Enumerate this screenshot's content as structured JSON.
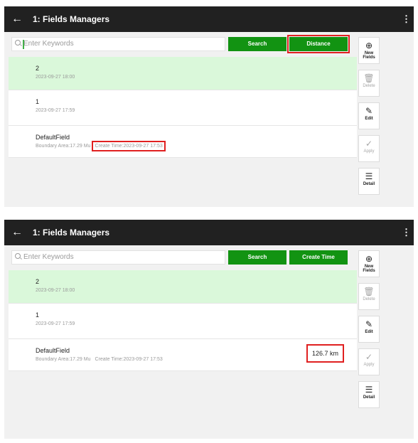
{
  "screens": [
    {
      "header": {
        "back": "←",
        "title": "1: Fields Managers",
        "menu": "⋮"
      },
      "search": {
        "placeholder": "Enter Keywords",
        "search_label": "Search",
        "sort_label": "Distance"
      },
      "fields": [
        {
          "name": "2",
          "detail": "2023-09-27 18:00"
        },
        {
          "name": "1",
          "detail": "2023-09-27 17:59"
        },
        {
          "name": "DefaultField",
          "detail": "Boundary Area:17.29 Mu",
          "create_time": "Create Time:2023-09-27 17:53"
        }
      ]
    },
    {
      "header": {
        "back": "←",
        "title": "1: Fields Managers",
        "menu": "⋮"
      },
      "search": {
        "placeholder": "Enter Keywords",
        "search_label": "Search",
        "sort_label": "Create Time"
      },
      "fields": [
        {
          "name": "2",
          "detail": "2023-09-27 18:00"
        },
        {
          "name": "1",
          "detail": "2023-09-27 17:59"
        },
        {
          "name": "DefaultField",
          "detail": "Boundary Area:17.29 Mu",
          "create_time": "Create Time:2023-09-27 17:53",
          "distance": "126.7 km"
        }
      ]
    }
  ],
  "side": {
    "new_icon": "⊕",
    "new_label": "New Fields",
    "delete_icon": "🗑",
    "delete_label": "Delete",
    "edit_icon": "✎",
    "edit_label": "Edit",
    "apply_icon": "✓",
    "apply_label": "Apply",
    "detail_icon": "☰",
    "detail_label": "Detail"
  },
  "icons": {
    "search": "search-icon",
    "back": "back-arrow-icon",
    "menu": "more-vert-icon"
  },
  "colors": {
    "header": "#212121",
    "button": "#129312",
    "selected_row": "#daf8da",
    "highlight": "#e02020"
  }
}
